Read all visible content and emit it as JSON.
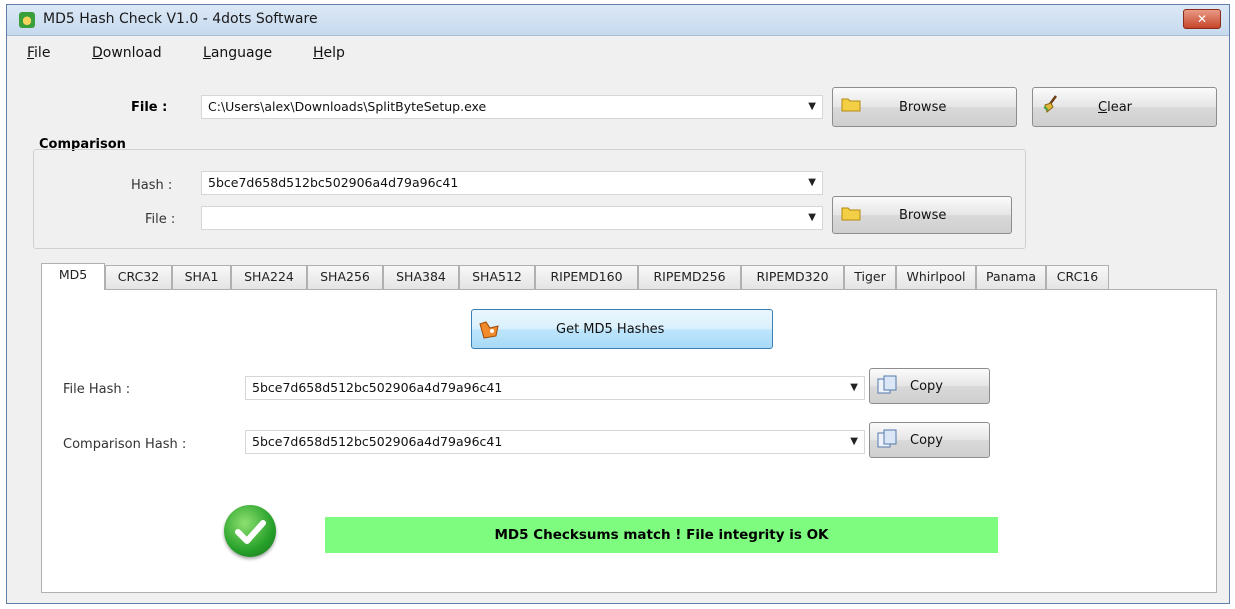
{
  "window": {
    "title": "MD5 Hash Check V1.0 - 4dots Software",
    "close_symbol": "✕"
  },
  "menu": {
    "items": [
      {
        "accel": "F",
        "rest": "ile"
      },
      {
        "accel": "D",
        "rest": "ownload"
      },
      {
        "accel": "L",
        "rest": "anguage"
      },
      {
        "accel": "H",
        "rest": "elp"
      }
    ]
  },
  "file_row": {
    "label": "File :",
    "value": "C:\\Users\\alex\\Downloads\\SplitByteSetup.exe",
    "browse_label": "Browse",
    "clear_accel": "C",
    "clear_rest": "lear"
  },
  "comparison": {
    "title": "Comparison",
    "hash_label": "Hash :",
    "hash_value": "5bce7d658d512bc502906a4d79a96c41",
    "file_label": "File :",
    "file_value": "",
    "browse_label": "Browse"
  },
  "tabs": [
    "MD5",
    "CRC32",
    "SHA1",
    "SHA224",
    "SHA256",
    "SHA384",
    "SHA512",
    "RIPEMD160",
    "RIPEMD256",
    "RIPEMD320",
    "Tiger",
    "Whirlpool",
    "Panama",
    "CRC16"
  ],
  "active_tab": "MD5",
  "panel": {
    "get_button": "Get MD5 Hashes",
    "file_hash_label": "File Hash :",
    "file_hash_value": "5bce7d658d512bc502906a4d79a96c41",
    "comparison_hash_label": "Comparison Hash :",
    "comparison_hash_value": "5bce7d658d512bc502906a4d79a96c41",
    "copy_label": "Copy",
    "status_text": "MD5 Checksums match ! File integrity is OK"
  },
  "colors": {
    "status_ok": "#7dfc7f",
    "title_bar": "#c6d9ee",
    "close": "#c6452b"
  },
  "icons": [
    "app-icon",
    "close-icon",
    "folder-icon",
    "broom-icon",
    "fox-icon",
    "copy-icon",
    "checkmark-icon",
    "chevron-down-icon"
  ]
}
